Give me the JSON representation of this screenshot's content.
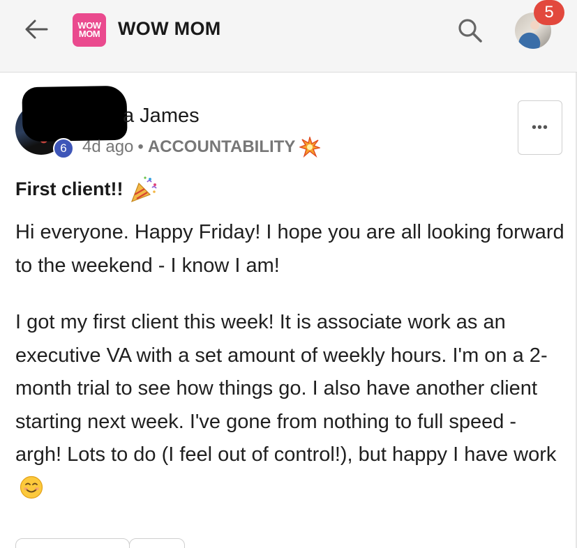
{
  "app": {
    "title": "WOW MOM",
    "logo_line1": "WOW",
    "logo_line2": "MOM",
    "notification_count": "5",
    "brand_color": "#ea4a8e",
    "badge_color": "#e2483d"
  },
  "post": {
    "author_name": "a James",
    "author_level": "6",
    "time_ago": "4d ago",
    "separator": "•",
    "category": "ACCOUNTABILITY",
    "category_icon": "collision-emoji-icon",
    "more_label": "•••",
    "title": "First client!!",
    "title_icon": "party-popper-emoji-icon",
    "paragraphs": [
      "Hi everyone. Happy Friday! I hope you are all looking forward to the weekend - I know I am!",
      "I got my first client this week! It is associate work as an executive VA with a set amount of weekly hours. I'm on a 2-month trial to see how things go. I also have another client starting next week. I've gone from nothing to full speed - argh! Lots to do (I feel out of control!), but happy I have work"
    ],
    "ending_icon": "smiling-face-emoji-icon"
  }
}
